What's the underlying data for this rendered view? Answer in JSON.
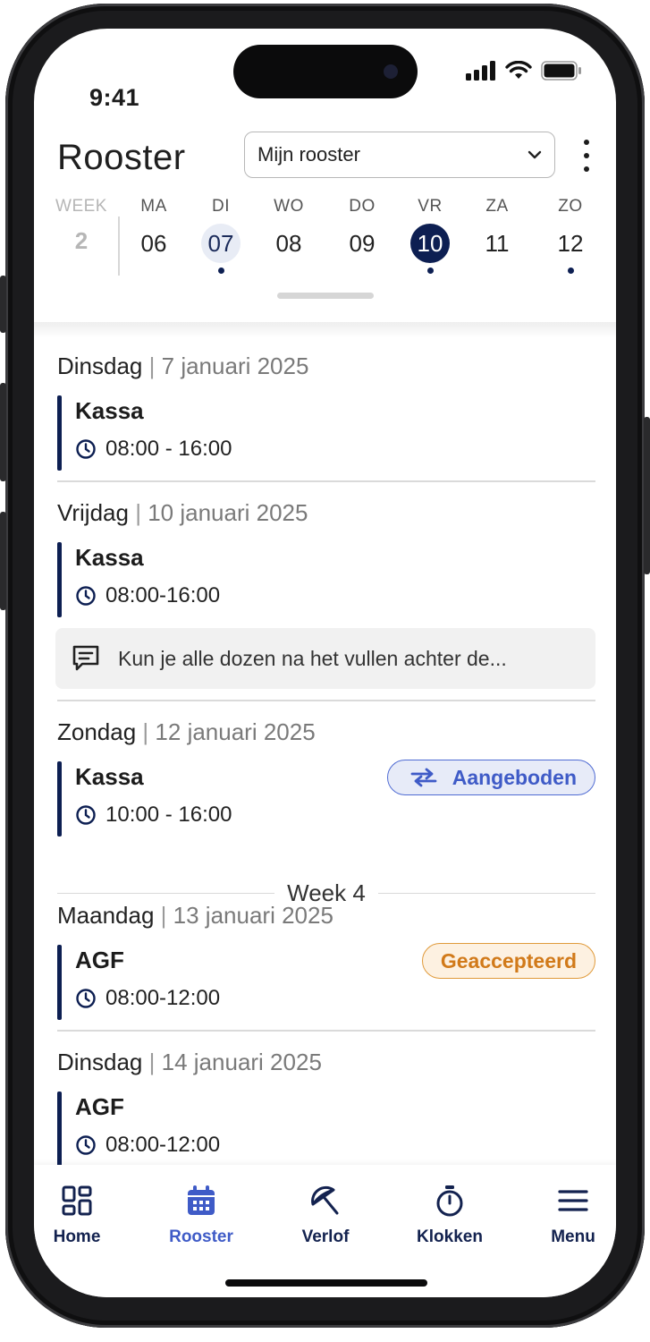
{
  "status": {
    "time": "9:41"
  },
  "header": {
    "title": "Rooster",
    "dropdown_value": "Mijn rooster"
  },
  "week_strip": {
    "week_label": "WEEK",
    "week_number": "2",
    "days": [
      {
        "label": "MA",
        "date": "06",
        "state": "normal",
        "has_shift": false
      },
      {
        "label": "DI",
        "date": "07",
        "state": "highlight",
        "has_shift": true
      },
      {
        "label": "WO",
        "date": "08",
        "state": "normal",
        "has_shift": false
      },
      {
        "label": "DO",
        "date": "09",
        "state": "normal",
        "has_shift": false
      },
      {
        "label": "VR",
        "date": "10",
        "state": "selected",
        "has_shift": true
      },
      {
        "label": "ZA",
        "date": "11",
        "state": "normal",
        "has_shift": false
      },
      {
        "label": "ZO",
        "date": "12",
        "state": "normal",
        "has_shift": true
      }
    ]
  },
  "schedule": {
    "d1": {
      "day": "Dinsdag",
      "sep": "|",
      "date": "7 januari 2025",
      "shift": "Kassa",
      "time": "08:00 - 16:00"
    },
    "d2": {
      "day": "Vrijdag",
      "sep": "|",
      "date": "10 januari 2025",
      "shift": "Kassa",
      "time": "08:00-16:00",
      "note": "Kun je alle dozen na het vullen achter de..."
    },
    "d3": {
      "day": "Zondag",
      "sep": "|",
      "date": "12 januari 2025",
      "shift": "Kassa",
      "time": "10:00 - 16:00",
      "badge": "Aangeboden"
    },
    "week_separator": "Week 4",
    "d4": {
      "day": "Maandag",
      "sep": "|",
      "date": "13 januari 2025",
      "shift": "AGF",
      "time": "08:00-12:00",
      "badge": "Geaccepteerd"
    },
    "d5": {
      "day": "Dinsdag",
      "sep": "|",
      "date": "14 januari 2025",
      "shift": "AGF",
      "time": "08:00-12:00"
    }
  },
  "nav": {
    "home": "Home",
    "rooster": "Rooster",
    "verlof": "Verlof",
    "klokken": "Klokken",
    "menu": "Menu",
    "active": "rooster"
  },
  "colors": {
    "navy": "#0d1f52",
    "accent_blue": "#3f5bc7",
    "accepted_orange": "#d17a1a"
  }
}
